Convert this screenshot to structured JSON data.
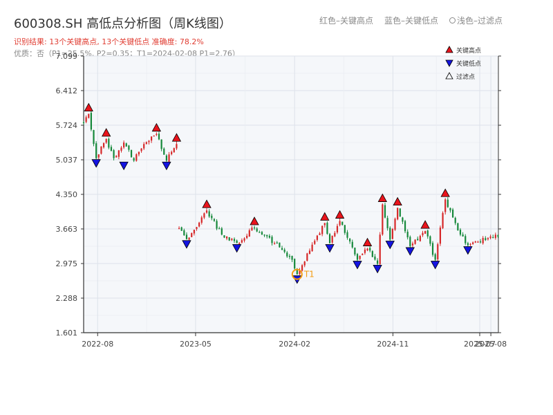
{
  "title": "600308.SH 高低点分析图（周K线图）",
  "summary": "识别结果: 13个关键高点, 13个关键低点  准确度: 78.2%",
  "quality": "优质：否（P1=25.5%, P2=0.35；T1=2024-02-08 P1=2.76）",
  "top_legend": {
    "red": "红色–关键高点",
    "blue": "蓝色–关键低点",
    "light": "浅色–过滤点"
  },
  "colors": {
    "up": "#d62728",
    "down": "#15883a",
    "high_marker": "#e8141c",
    "low_marker": "#1414e0",
    "t1": "#f39c12",
    "plot_bg": "#f5f7fa"
  },
  "chart_data": {
    "type": "candlestick",
    "yticks": [
      "1.601",
      "2.288",
      "2.975",
      "3.663",
      "4.350",
      "5.037",
      "5.724",
      "6.412",
      "7.099"
    ],
    "ylim": [
      1.601,
      7.099
    ],
    "xticks": [
      "2022-08",
      "2023-05",
      "2024-02",
      "2024-11",
      "2025-07",
      "2025-08"
    ],
    "xlim": [
      "2022-06-23",
      "2025-08-22"
    ],
    "legend": [
      {
        "label": "关键高点",
        "marker": "triangle-up",
        "color": "#e8141c"
      },
      {
        "label": "关键低点",
        "marker": "triangle-down",
        "color": "#1414e0"
      },
      {
        "label": "过滤点",
        "marker": "triangle-up-hollow",
        "color": "#000000"
      }
    ],
    "segments": [
      {
        "start": "2022-06-23",
        "end": "2023-03-09",
        "points": [
          [
            "2022-06-23",
            5.78
          ],
          [
            "2022-07-07",
            5.95
          ],
          [
            "2022-07-28",
            5.07
          ],
          [
            "2022-08-25",
            5.45
          ],
          [
            "2022-09-15",
            5.07
          ],
          [
            "2022-10-13",
            5.38
          ],
          [
            "2022-11-10",
            5.02
          ],
          [
            "2022-12-08",
            5.35
          ],
          [
            "2023-01-12",
            5.55
          ],
          [
            "2023-02-09",
            5.02
          ],
          [
            "2023-03-09",
            5.35
          ]
        ]
      },
      {
        "start": "2023-03-16",
        "end": "2025-08-22",
        "points": [
          [
            "2023-03-16",
            3.68
          ],
          [
            "2023-04-06",
            3.46
          ],
          [
            "2023-06-01",
            4.03
          ],
          [
            "2023-07-13",
            3.55
          ],
          [
            "2023-08-24",
            3.38
          ],
          [
            "2023-10-12",
            3.69
          ],
          [
            "2023-12-07",
            3.38
          ],
          [
            "2024-01-25",
            3.05
          ],
          [
            "2024-02-08",
            2.76
          ],
          [
            "2024-03-21",
            3.35
          ],
          [
            "2024-04-25",
            3.78
          ],
          [
            "2024-05-09",
            3.38
          ],
          [
            "2024-06-06",
            3.82
          ],
          [
            "2024-07-25",
            3.05
          ],
          [
            "2024-08-22",
            3.27
          ],
          [
            "2024-09-19",
            2.97
          ],
          [
            "2024-09-26",
            3.55
          ],
          [
            "2024-10-03",
            4.15
          ],
          [
            "2024-10-24",
            3.45
          ],
          [
            "2024-11-14",
            4.08
          ],
          [
            "2024-12-19",
            3.32
          ],
          [
            "2025-01-30",
            3.62
          ],
          [
            "2025-02-27",
            3.05
          ],
          [
            "2025-03-27",
            4.25
          ],
          [
            "2025-05-08",
            3.55
          ],
          [
            "2025-05-29",
            3.34
          ],
          [
            "2025-08-22",
            3.55
          ]
        ]
      }
    ],
    "key_highs": [
      {
        "date": "2022-07-07",
        "value": 5.95
      },
      {
        "date": "2022-08-25",
        "value": 5.45
      },
      {
        "date": "2023-01-12",
        "value": 5.55
      },
      {
        "date": "2023-03-09",
        "value": 5.35
      },
      {
        "date": "2023-06-01",
        "value": 4.03
      },
      {
        "date": "2023-10-12",
        "value": 3.69
      },
      {
        "date": "2024-04-25",
        "value": 3.78
      },
      {
        "date": "2024-06-06",
        "value": 3.82
      },
      {
        "date": "2024-08-22",
        "value": 3.27
      },
      {
        "date": "2024-10-03",
        "value": 4.15
      },
      {
        "date": "2024-11-14",
        "value": 4.08
      },
      {
        "date": "2025-01-30",
        "value": 3.62
      },
      {
        "date": "2025-03-27",
        "value": 4.25
      }
    ],
    "key_lows": [
      {
        "date": "2022-07-28",
        "value": 5.07
      },
      {
        "date": "2022-10-13",
        "value": 5.02
      },
      {
        "date": "2023-02-09",
        "value": 5.02
      },
      {
        "date": "2023-04-06",
        "value": 3.46
      },
      {
        "date": "2023-08-24",
        "value": 3.38
      },
      {
        "date": "2024-02-08",
        "value": 2.76
      },
      {
        "date": "2024-05-09",
        "value": 3.38
      },
      {
        "date": "2024-07-25",
        "value": 3.05
      },
      {
        "date": "2024-09-19",
        "value": 2.97
      },
      {
        "date": "2024-10-24",
        "value": 3.45
      },
      {
        "date": "2024-12-19",
        "value": 3.32
      },
      {
        "date": "2025-02-27",
        "value": 3.05
      },
      {
        "date": "2025-05-29",
        "value": 3.34
      }
    ],
    "t1": {
      "label": "T1",
      "date": "2024-02-08",
      "value": 2.76
    }
  }
}
